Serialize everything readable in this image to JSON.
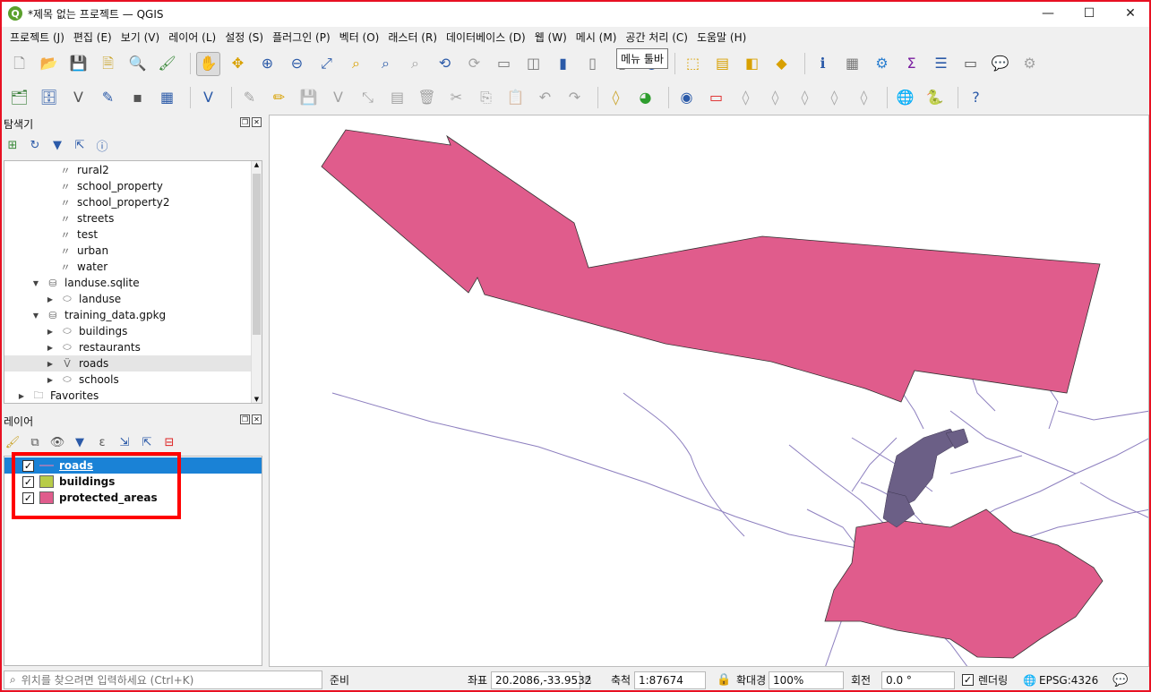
{
  "window": {
    "title": "*제목 없는 프로젝트 — QGIS",
    "logo": "Q",
    "minimize": "—",
    "maximize": "☐",
    "close": "✕"
  },
  "menus": [
    "프로젝트 (J)",
    "편집 (E)",
    "보기 (V)",
    "레이어 (L)",
    "설정 (S)",
    "플러그인 (P)",
    "벡터 (O)",
    "래스터 (R)",
    "데이터베이스 (D)",
    "웹 (W)",
    "메시 (M)",
    "공간 처리 (C)",
    "도움말 (H)"
  ],
  "tooltip": "메뉴 툴바",
  "browser_panel": {
    "title": "탐색기",
    "items": [
      {
        "label": "rural2",
        "kind": "layer"
      },
      {
        "label": "school_property",
        "kind": "layer"
      },
      {
        "label": "school_property2",
        "kind": "layer"
      },
      {
        "label": "streets",
        "kind": "layer"
      },
      {
        "label": "test",
        "kind": "layer"
      },
      {
        "label": "urban",
        "kind": "layer"
      },
      {
        "label": "water",
        "kind": "layer"
      },
      {
        "label": "landuse.sqlite",
        "kind": "db"
      },
      {
        "label": "landuse",
        "kind": "poly"
      },
      {
        "label": "training_data.gpkg",
        "kind": "db"
      },
      {
        "label": "buildings",
        "kind": "poly"
      },
      {
        "label": "restaurants",
        "kind": "poly"
      },
      {
        "label": "roads",
        "kind": "line"
      },
      {
        "label": "schools",
        "kind": "poly"
      },
      {
        "label": "Favorites",
        "kind": "folder"
      }
    ]
  },
  "layers_panel": {
    "title": "레이어",
    "layers": [
      {
        "name": "roads",
        "checked": "✓",
        "symbol": "line",
        "color": "#8d7fbf",
        "selected": true
      },
      {
        "name": "buildings",
        "checked": "✓",
        "symbol": "fill",
        "color": "#b8cc48",
        "selected": false
      },
      {
        "name": "protected_areas",
        "checked": "✓",
        "symbol": "fill",
        "color": "#e05c8c",
        "selected": false
      }
    ]
  },
  "status": {
    "locator_placeholder": "위치를 찾으려면 입력하세요 (Ctrl+K)",
    "ready": "준비",
    "coord_label": "좌표",
    "coord_value": "20.2086,-33.9532",
    "scale_label": "축척",
    "scale_value": "1:87674",
    "magnifier_label": "확대경",
    "magnifier_value": "100%",
    "rotation_label": "회전",
    "rotation_value": "0.0 °",
    "render_label": "렌더링",
    "render_checked": "✓",
    "crs": "EPSG:4326"
  },
  "colors": {
    "protected_fill": "#e05c8c",
    "road_line": "#8d7fbf",
    "buildings_fill": "#b8cc48",
    "selection": "#1a82d6",
    "highlight_box": "#ff0000"
  }
}
